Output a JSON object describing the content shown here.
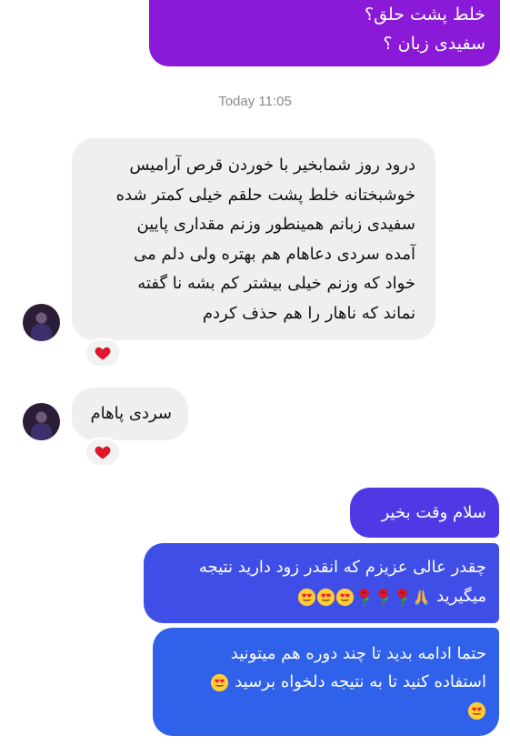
{
  "thread": {
    "top_sent_message": {
      "lines": [
        "خلط پشت حلق؟",
        "سفیدی زبان ؟"
      ],
      "color": "#8b1ad8"
    },
    "timestamp": "Today 11:05",
    "received_messages": [
      {
        "lines": [
          "درود روز شمابخیر با خوردن قرص آرامیس",
          "خوشبختانه خلط پشت حلقم خیلی کمتر شده",
          "سفیدی زبانم همینطور وزنم مقداری پایین",
          "آمده سردی دعاهام هم بهتره ولی دلم می",
          "خواد که وزنم خیلی بیشتر کم بشه نا گفته",
          "نماند که ناهار را هم حذف کردم"
        ],
        "reaction": "heart-icon"
      },
      {
        "lines": [
          "سردی پاهام"
        ],
        "reaction": "heart-icon"
      }
    ],
    "sent_messages": [
      {
        "lines": [
          "سلام وقت بخیر"
        ],
        "color": "#4e39e4"
      },
      {
        "lines": [
          "چقدر عالی عزیزم که انقدر زود دارید  نتیجه",
          "میگیرید"
        ],
        "emoji_sequence": [
          "pray-icon",
          "rose-icon",
          "rose-icon",
          "rose-icon",
          "heart-eyes-icon",
          "heart-eyes-icon",
          "heart-eyes-icon"
        ],
        "color": "#3f4ee6"
      },
      {
        "lines": [
          "حتما ادامه بدید تا چند دوره هم میتونید",
          "استفاده کنید تا به نتیجه دلخواه برسید"
        ],
        "emoji_sequence": [
          "heart-eyes-icon",
          "heart-eyes-icon"
        ],
        "color": "#2f61ea"
      }
    ],
    "colors": {
      "received_bubble": "#efefef",
      "reaction_heart": "#e0162b"
    }
  }
}
